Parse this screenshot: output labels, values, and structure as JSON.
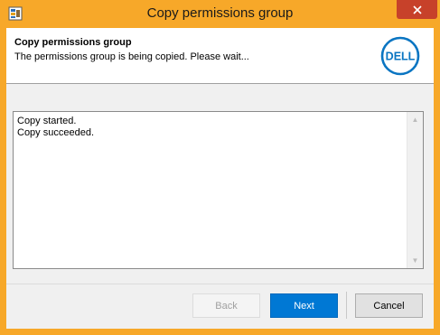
{
  "window": {
    "title": "Copy permissions group",
    "app_icon": "app-icon",
    "close_icon": "close-icon",
    "accent_color": "#f7a829"
  },
  "header": {
    "title": "Copy permissions group",
    "subtitle": "The permissions group is being copied. Please wait...",
    "logo_text": "DELL"
  },
  "log": {
    "lines": [
      "Copy started.",
      "Copy succeeded."
    ]
  },
  "buttons": {
    "back": "Back",
    "next": "Next",
    "cancel": "Cancel"
  }
}
